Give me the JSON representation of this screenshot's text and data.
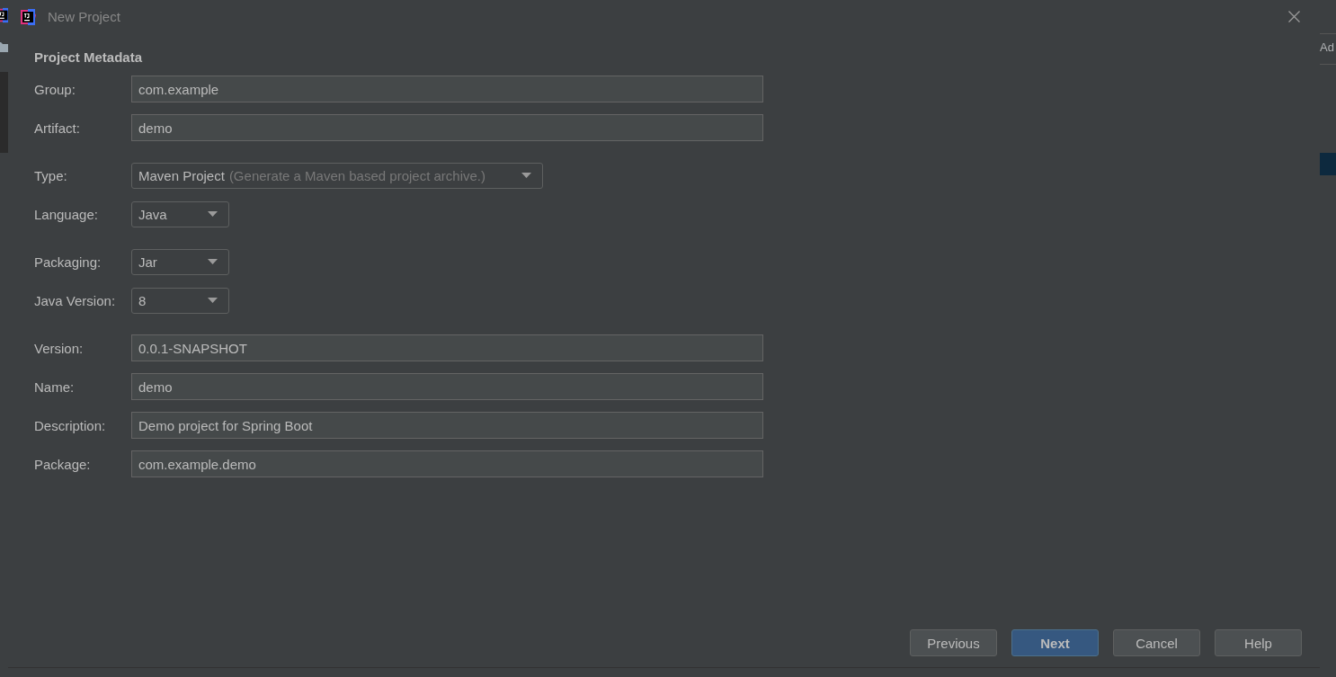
{
  "ide": {
    "right_edge_text": "Ad"
  },
  "dialog": {
    "title": "New Project",
    "section": "Project Metadata",
    "groups": [
      {
        "rows": [
          {
            "label": "Group:",
            "kind": "text",
            "value": "com.example"
          },
          {
            "label": "Artifact:",
            "kind": "text",
            "value": "demo"
          }
        ]
      },
      {
        "rows": [
          {
            "label": "Type:",
            "kind": "dropdown",
            "value": "Maven Project",
            "hint": "(Generate a Maven based project archive.)"
          },
          {
            "label": "Language:",
            "kind": "dropdown",
            "value": "Java"
          }
        ]
      },
      {
        "rows": [
          {
            "label": "Packaging:",
            "kind": "dropdown",
            "value": "Jar"
          },
          {
            "label": "Java Version:",
            "kind": "dropdown",
            "value": "8"
          }
        ]
      },
      {
        "rows": [
          {
            "label": "Version:",
            "kind": "text",
            "value": "0.0.1-SNAPSHOT"
          },
          {
            "label": "Name:",
            "kind": "text",
            "value": "demo"
          },
          {
            "label": "Description:",
            "kind": "text",
            "value": "Demo project for Spring Boot"
          },
          {
            "label": "Package:",
            "kind": "text",
            "value": "com.example.demo"
          }
        ]
      }
    ],
    "buttons": [
      {
        "label": "Previous",
        "primary": false
      },
      {
        "label": "Next",
        "primary": true
      },
      {
        "label": "Cancel",
        "primary": false
      },
      {
        "label": "Help",
        "primary": false
      }
    ]
  }
}
